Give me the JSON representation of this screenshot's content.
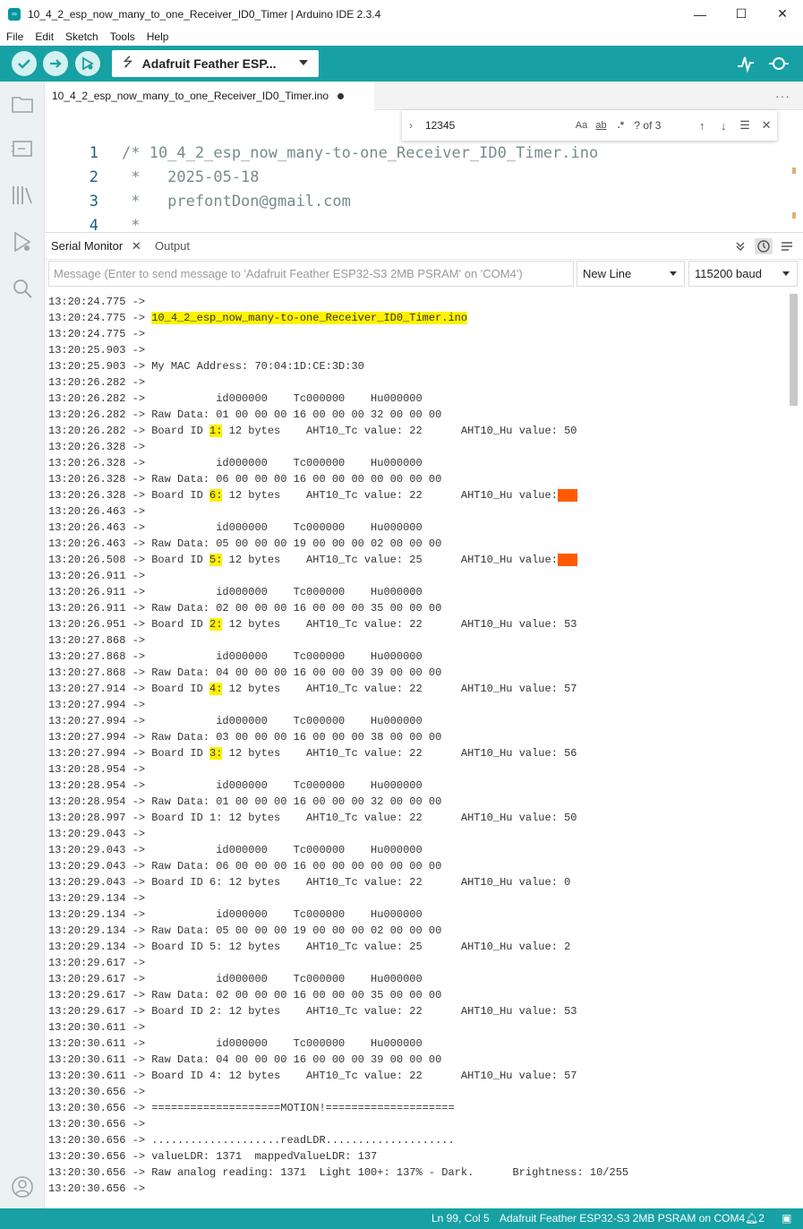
{
  "window": {
    "title": "10_4_2_esp_now_many_to_one_Receiver_ID0_Timer | Arduino IDE 2.3.4",
    "controls": [
      "—",
      "☐",
      "✕"
    ]
  },
  "menu": [
    "File",
    "Edit",
    "Sketch",
    "Tools",
    "Help"
  ],
  "toolbar": {
    "board": "Adafruit Feather ESP..."
  },
  "editor": {
    "tab_label": "10_4_2_esp_now_many_to_one_Receiver_ID0_Timer.ino",
    "lines": [
      {
        "num": "1",
        "text": "/* 10_4_2_esp_now_many-to-one_Receiver_ID0_Timer.ino"
      },
      {
        "num": "2",
        "text": " *   2025-05-18"
      },
      {
        "num": "3",
        "text": " *   prefontDon@gmail.com"
      },
      {
        "num": "4",
        "text": " *"
      }
    ]
  },
  "find": {
    "query": "12345",
    "match_case": "Aa",
    "whole_word": "ab",
    "regex": ".*",
    "count": "? of 3"
  },
  "panel": {
    "serial_tab": "Serial Monitor",
    "output_tab": "Output",
    "message_placeholder": "Message (Enter to send message to 'Adafruit Feather ESP32-S3 2MB PSRAM' on 'COM4')",
    "line_ending": "New Line",
    "baud": "115200 baud"
  },
  "serial_output": [
    "13:20:24.775 -> ",
    "13:20:24.775 -> 10_4_2_esp_now_many-to-one_Receiver_ID0_Timer.ino",
    "13:20:24.775 -> ",
    "13:20:25.903 -> ",
    "13:20:25.903 -> My MAC Address: 70:04:1D:CE:3D:30",
    "13:20:26.282 -> ",
    "13:20:26.282 ->           id000000    Tc000000    Hu000000",
    "13:20:26.282 -> Raw Data: 01 00 00 00 16 00 00 00 32 00 00 00",
    "13:20:26.282 -> Board ID 1: 12 bytes    AHT10_Tc value: 22      AHT10_Hu value: 50",
    "13:20:26.328 -> ",
    "13:20:26.328 ->           id000000    Tc000000    Hu000000",
    "13:20:26.328 -> Raw Data: 06 00 00 00 16 00 00 00 00 00 00 00",
    "13:20:26.328 -> Board ID 6: 12 bytes    AHT10_Tc value: 22      AHT10_Hu value: 0",
    "13:20:26.463 -> ",
    "13:20:26.463 ->           id000000    Tc000000    Hu000000",
    "13:20:26.463 -> Raw Data: 05 00 00 00 19 00 00 00 02 00 00 00",
    "13:20:26.508 -> Board ID 5: 12 bytes    AHT10_Tc value: 25      AHT10_Hu value: 2",
    "13:20:26.911 -> ",
    "13:20:26.911 ->           id000000    Tc000000    Hu000000",
    "13:20:26.911 -> Raw Data: 02 00 00 00 16 00 00 00 35 00 00 00",
    "13:20:26.951 -> Board ID 2: 12 bytes    AHT10_Tc value: 22      AHT10_Hu value: 53",
    "13:20:27.868 -> ",
    "13:20:27.868 ->           id000000    Tc000000    Hu000000",
    "13:20:27.868 -> Raw Data: 04 00 00 00 16 00 00 00 39 00 00 00",
    "13:20:27.914 -> Board ID 4: 12 bytes    AHT10_Tc value: 22      AHT10_Hu value: 57",
    "13:20:27.994 -> ",
    "13:20:27.994 ->           id000000    Tc000000    Hu000000",
    "13:20:27.994 -> Raw Data: 03 00 00 00 16 00 00 00 38 00 00 00",
    "13:20:27.994 -> Board ID 3: 12 bytes    AHT10_Tc value: 22      AHT10_Hu value: 56",
    "13:20:28.954 -> ",
    "13:20:28.954 ->           id000000    Tc000000    Hu000000",
    "13:20:28.954 -> Raw Data: 01 00 00 00 16 00 00 00 32 00 00 00",
    "13:20:28.997 -> Board ID 1: 12 bytes    AHT10_Tc value: 22      AHT10_Hu value: 50",
    "13:20:29.043 -> ",
    "13:20:29.043 ->           id000000    Tc000000    Hu000000",
    "13:20:29.043 -> Raw Data: 06 00 00 00 16 00 00 00 00 00 00 00",
    "13:20:29.043 -> Board ID 6: 12 bytes    AHT10_Tc value: 22      AHT10_Hu value: 0",
    "13:20:29.134 -> ",
    "13:20:29.134 ->           id000000    Tc000000    Hu000000",
    "13:20:29.134 -> Raw Data: 05 00 00 00 19 00 00 00 02 00 00 00",
    "13:20:29.134 -> Board ID 5: 12 bytes    AHT10_Tc value: 25      AHT10_Hu value: 2",
    "13:20:29.617 -> ",
    "13:20:29.617 ->           id000000    Tc000000    Hu000000",
    "13:20:29.617 -> Raw Data: 02 00 00 00 16 00 00 00 35 00 00 00",
    "13:20:29.617 -> Board ID 2: 12 bytes    AHT10_Tc value: 22      AHT10_Hu value: 53",
    "13:20:30.611 -> ",
    "13:20:30.611 ->           id000000    Tc000000    Hu000000",
    "13:20:30.611 -> Raw Data: 04 00 00 00 16 00 00 00 39 00 00 00",
    "13:20:30.611 -> Board ID 4: 12 bytes    AHT10_Tc value: 22      AHT10_Hu value: 57",
    "13:20:30.656 -> ",
    "13:20:30.656 -> ====================MOTION!====================",
    "13:20:30.656 -> ",
    "13:20:30.656 -> ....................readLDR....................",
    "13:20:30.656 -> valueLDR: 1371  mappedValueLDR: 137",
    "13:20:30.656 -> Raw analog reading: 1371  Light 100+: 137% - Dark.      Brightness: 10/255",
    "13:20:30.656 -> "
  ],
  "highlights": {
    "yellow": [
      "10_4_2_esp_now_many-to-one_Receiver_ID0_Timer.ino",
      "1",
      "6",
      "5",
      "2",
      "4",
      "3"
    ],
    "orange": [
      "0",
      "2"
    ],
    "colors": {
      "yellow": "#fff200",
      "orange": "#ff5a00"
    }
  },
  "status": {
    "position": "Ln 99, Col 5",
    "board": "Adafruit Feather ESP32-S3 2MB PSRAM on COM4",
    "notifications": "2"
  },
  "colors": {
    "accent": "#17a1a5",
    "toolbar_button": "#d5f0f0"
  }
}
